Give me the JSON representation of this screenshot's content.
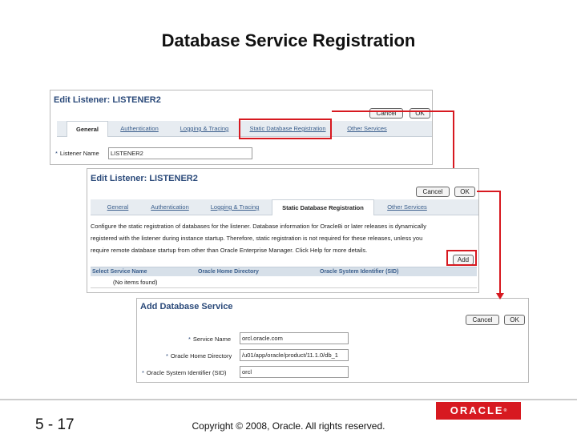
{
  "title": "Database Service Registration",
  "screen1": {
    "title": "Edit Listener: LISTENER2",
    "cancel": "Cancel",
    "ok": "OK",
    "tabs": [
      "General",
      "Authentication",
      "Logging & Tracing",
      "Static Database Registration",
      "Other Services"
    ],
    "field_label": "Listener Name",
    "field_value": "LISTENER2"
  },
  "screen2": {
    "title": "Edit Listener: LISTENER2",
    "cancel": "Cancel",
    "ok": "OK",
    "tabs": [
      "General",
      "Authentication",
      "Logging & Tracing",
      "Static Database Registration",
      "Other Services"
    ],
    "description": [
      "Configure the static registration of databases for the listener. Database information for Oracle8i or later releases is dynamically",
      "registered with the listener during instance startup. Therefore, static registration is not required for these releases, unless you",
      "require remote database startup from other than Oracle Enterprise Manager. Click Help for more details."
    ],
    "add": "Add",
    "columns": [
      "Select Service Name",
      "Oracle Home Directory",
      "Oracle System Identifier (SID)"
    ],
    "empty_row": "(No items found)"
  },
  "screen3": {
    "title": "Add Database Service",
    "cancel": "Cancel",
    "ok": "OK",
    "fields": [
      {
        "label": "Service Name",
        "value": "orcl.oracle.com"
      },
      {
        "label": "Oracle Home Directory",
        "value": "/u01/app/oracle/product/11.1.0/db_1"
      },
      {
        "label": "Oracle System Identifier (SID)",
        "value": "orcl"
      }
    ]
  },
  "footer": {
    "slide_number": "5 - 17",
    "copyright": "Copyright © 2008, Oracle. All rights reserved.",
    "logo": "ORACLE"
  },
  "colors": {
    "highlight": "#d71920",
    "link": "#3a5e8c",
    "tab_bar": "#e7ecf1"
  }
}
